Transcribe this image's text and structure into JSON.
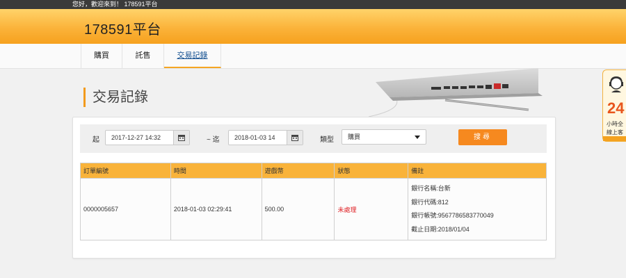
{
  "topbar": {
    "greeting": "您好，歡迎來到！ 178591平台"
  },
  "header": {
    "brand": "178591平台"
  },
  "nav": [
    {
      "label": "購買"
    },
    {
      "label": "託售"
    },
    {
      "label": "交易記錄"
    }
  ],
  "page": {
    "title": "交易記錄"
  },
  "filters": {
    "from_label": "起",
    "from_value": "2017-12-27 14:32",
    "to_label": "~ 迄",
    "to_value": "2018-01-03 14",
    "type_label": "類型",
    "type_value": "購買",
    "search_label": "搜尋"
  },
  "table": {
    "headers": [
      "訂單編號",
      "時間",
      "遊戲幣",
      "狀態",
      "備註"
    ],
    "rows": [
      {
        "order_no": "0000005657",
        "time": "2018-01-03 02:29:41",
        "coins": "500.00",
        "status": "未處理",
        "notes": [
          "銀行名稱:台新",
          "銀行代碼:812",
          "銀行帳號:9567786583770049",
          "截止日期:2018/01/04"
        ]
      }
    ]
  },
  "side_widget": {
    "number": "24",
    "line1": "小時全",
    "line2": "線上客"
  },
  "colors": {
    "accent": "#f6891f",
    "header": "#fbb33a",
    "status": "#e0262a"
  }
}
